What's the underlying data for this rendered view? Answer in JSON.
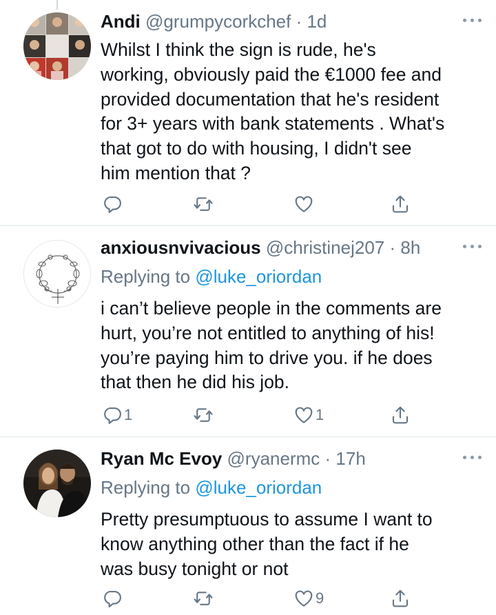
{
  "tweets": [
    {
      "name": "Andi",
      "handle": "@grumpycorkchef",
      "time": "· 1d",
      "reply_label": "",
      "reply_mention": "",
      "body_lines": [
        "Whilst I think the sign is rude, he's",
        "working, obviously paid the €1000 fee and",
        "provided documentation that he's resident",
        "for 3+ years with bank statements . What's",
        "that got to do with housing, I didn't see",
        "him mention that ?"
      ],
      "reply_count": "",
      "retweet_count": "",
      "like_count": "",
      "avatar_icon": "avatar-photo-collage"
    },
    {
      "name": "anxiousnvivacious",
      "handle": "@christinej207",
      "time": "· 8h",
      "reply_label": "Replying to",
      "reply_mention": "@luke_oriordan",
      "body_lines": [
        "i can’t believe people in the comments are",
        "hurt, you’re not entitled to anything of his!",
        "you’re paying him to drive you. if he does",
        "that then he did his job."
      ],
      "reply_count": "1",
      "retweet_count": "",
      "like_count": "1",
      "avatar_icon": "floral-wreath-drawing"
    },
    {
      "name": "Ryan Mc Evoy",
      "handle": "@ryanermc",
      "time": "· 17h",
      "reply_label": "Replying to",
      "reply_mention": "@luke_oriordan",
      "body_lines": [
        "Pretty presumptuous to assume I want to",
        "know anything other than the fact if he",
        "was busy tonight or not"
      ],
      "reply_count": "",
      "retweet_count": "",
      "like_count": "9",
      "avatar_icon": "avatar-couple-photo"
    }
  ],
  "colors": {
    "text": "#0f1419",
    "secondary": "#657786",
    "link": "#1b95e0",
    "divider": "#e1e8ed",
    "icon": "#657786"
  }
}
